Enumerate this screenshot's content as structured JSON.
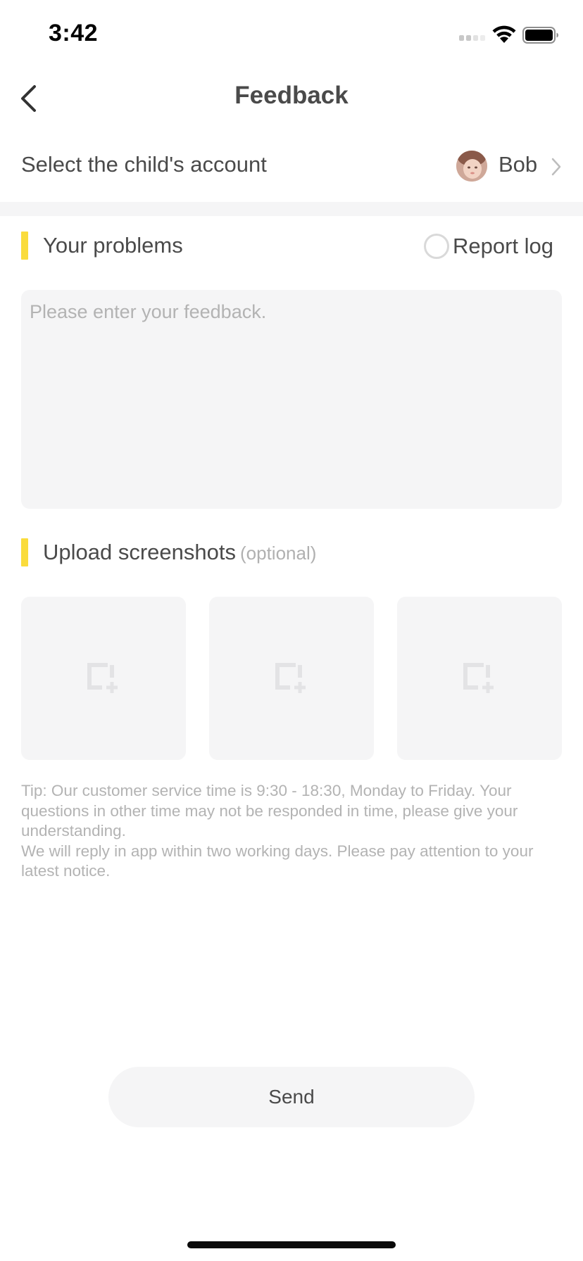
{
  "status_bar": {
    "time": "3:42",
    "icons": [
      "signal-icon",
      "wifi-icon",
      "battery-icon"
    ]
  },
  "nav": {
    "title": "Feedback",
    "back_icon": "chevron-left-icon"
  },
  "account": {
    "label": "Select the child's account",
    "name": "Bob",
    "avatar_icon": "avatar",
    "chevron_icon": "chevron-right-icon"
  },
  "problems": {
    "title": "Your problems",
    "report_log_label": "Report log",
    "report_log_checked": false,
    "placeholder": "Please enter your feedback.",
    "value": ""
  },
  "upload": {
    "title": "Upload screenshots",
    "optional": "(optional)",
    "slot_icon": "add-image-icon",
    "slot_count": 3
  },
  "tip": {
    "line1": "Tip: Our customer service time is 9:30 - 18:30, Monday to Friday. Your questions in other time may not be responded in time, please give your understanding.",
    "line2": "We will reply in app within two working days. Please pay attention to your latest notice."
  },
  "send_label": "Send",
  "colors": {
    "accent": "#fadc3c",
    "surface": "#f5f5f6",
    "text": "#4a4a4a",
    "muted": "#b3b3b3"
  }
}
